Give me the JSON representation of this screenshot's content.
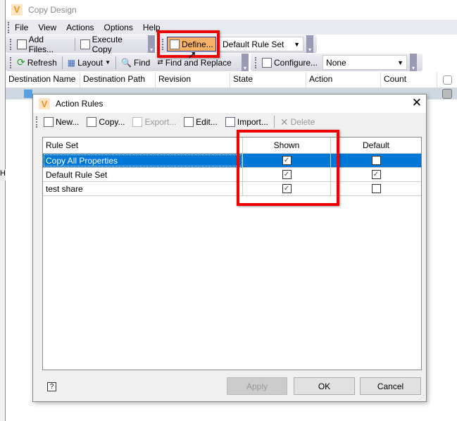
{
  "window": {
    "title": "Copy Design",
    "logo": "V"
  },
  "menu": [
    "File",
    "View",
    "Actions",
    "Options",
    "Help"
  ],
  "toolbar1": {
    "add_files": "Add Files...",
    "execute_copy": "Execute Copy",
    "define": "Define...",
    "rule_set": "Default Rule Set"
  },
  "toolbar2": {
    "refresh": "Refresh",
    "layout": "Layout",
    "find": "Find",
    "find_replace": "Find and Replace",
    "configure": "Configure...",
    "filter": "None"
  },
  "table": {
    "columns": [
      "Destination Name",
      "Destination Path",
      "Revision",
      "State",
      "Action",
      "Count"
    ]
  },
  "background_text": "Hi",
  "dialog": {
    "title": "Action Rules",
    "toolbar": {
      "new": "New...",
      "copy": "Copy...",
      "export": "Export...",
      "edit": "Edit...",
      "import": "Import...",
      "delete": "Delete"
    },
    "columns": [
      "Rule Set",
      "Shown",
      "Default"
    ],
    "rows": [
      {
        "name": "Copy All Properties",
        "shown": true,
        "default": false,
        "selected": true
      },
      {
        "name": "Default Rule Set",
        "shown": true,
        "default": true
      },
      {
        "name": "test share",
        "shown": true,
        "default": false
      }
    ],
    "buttons": {
      "help": "?",
      "apply": "Apply",
      "ok": "OK",
      "cancel": "Cancel"
    }
  },
  "colors": {
    "selection": "#0078d7",
    "highlight": "#e00000",
    "define_button": "#f7b267"
  }
}
